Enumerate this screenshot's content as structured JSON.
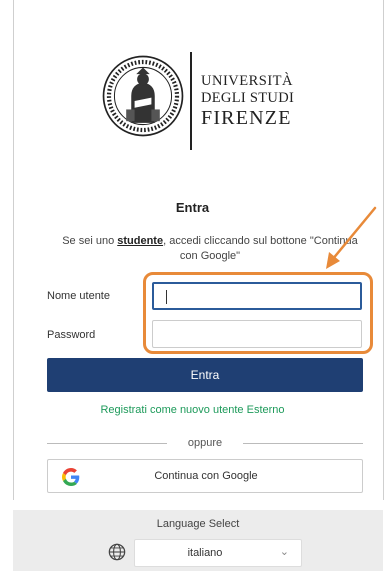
{
  "logo": {
    "line1": "UNIVERSITÀ",
    "line2": "DEGLI STUDI",
    "line3": "FIRENZE"
  },
  "form": {
    "title": "Entra",
    "info_prefix": "Se sei uno ",
    "info_link": "studente",
    "info_suffix": ", accedi cliccando sul bottone \"Continua con Google\"",
    "username_label": "Nome utente",
    "password_label": "Password",
    "submit_label": "Entra",
    "register_link": "Registrati come nuovo utente Esterno",
    "separator": "oppure",
    "google_button": "Continua con Google"
  },
  "footer": {
    "title": "Language Select",
    "language_value": "italiano"
  },
  "colors": {
    "primary": "#1f3f73",
    "register_link": "#1d9a5a",
    "highlight": "#e88a39"
  }
}
